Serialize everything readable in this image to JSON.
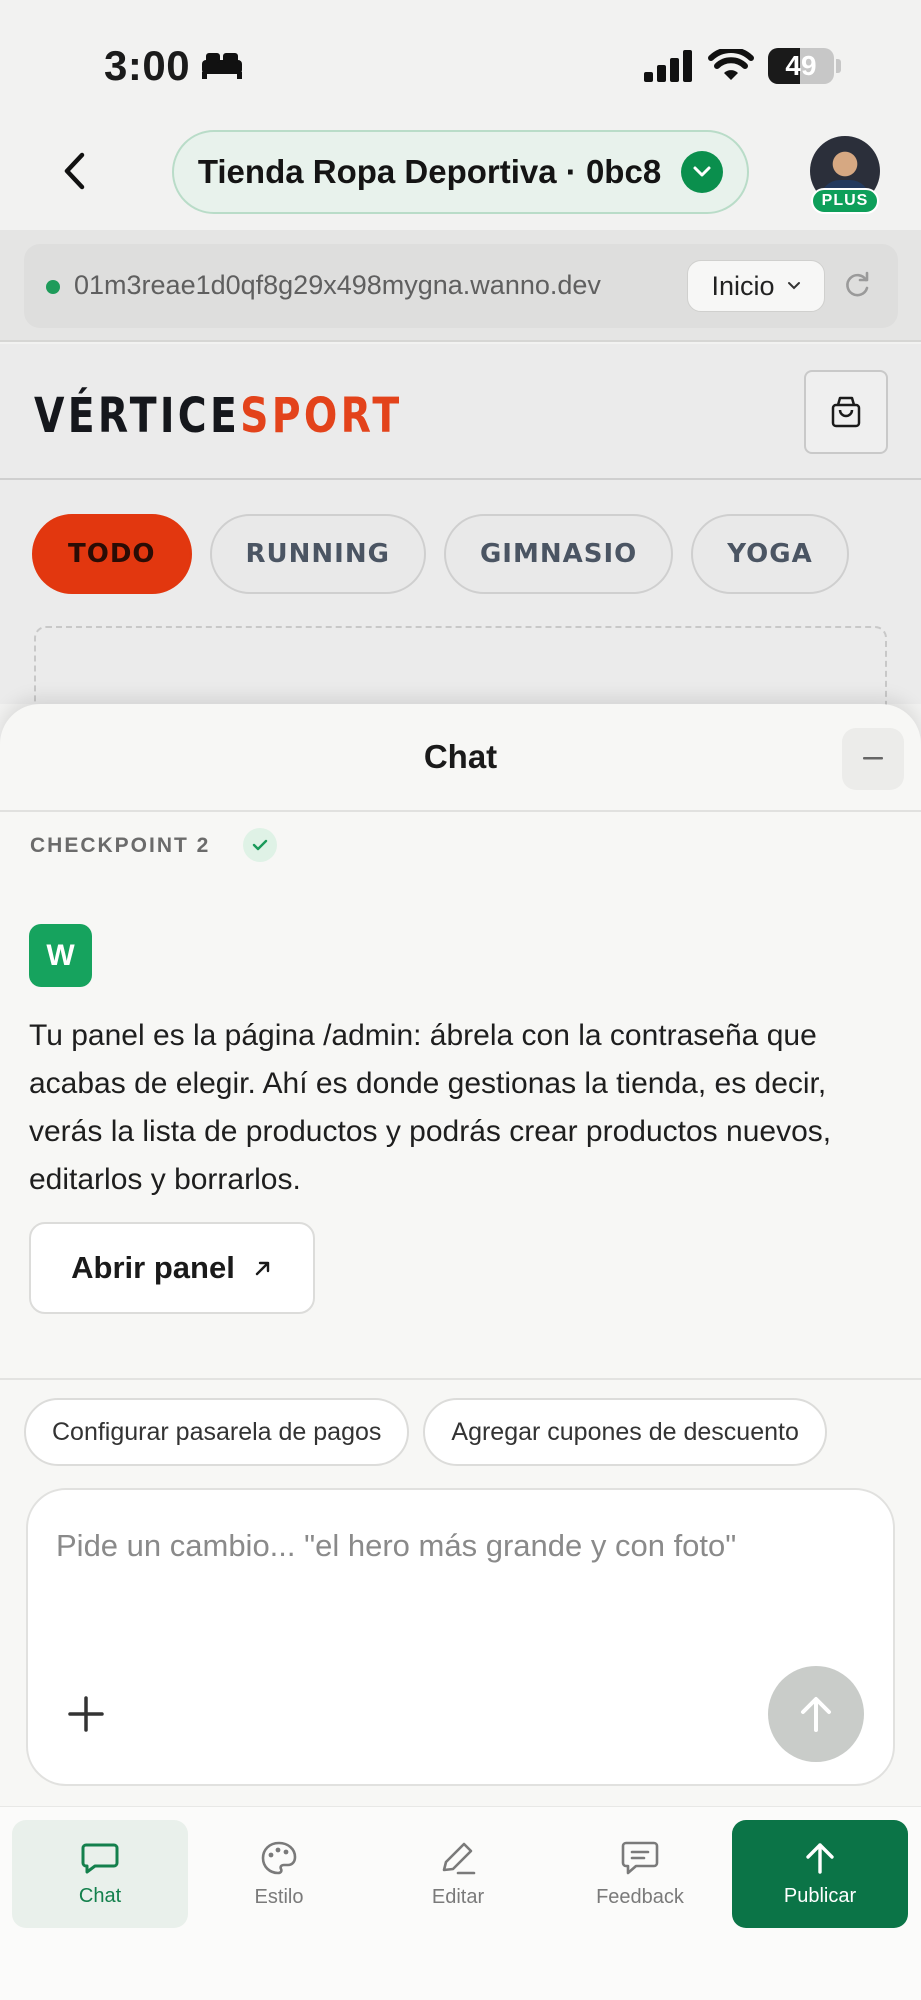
{
  "status_bar": {
    "time": "3:00",
    "battery": "49",
    "battery_level": 0.49
  },
  "header": {
    "project_name": "Tienda Ropa Deportiva · 0bc8",
    "badge": "PLUS"
  },
  "url_bar": {
    "url": "01m3reae1d0qf8g29x498mygna.wanno.dev",
    "route": "Inicio"
  },
  "preview": {
    "brand_part1": "VÉRTICE",
    "brand_part2": "SPORT",
    "categories": [
      "TODO",
      "RUNNING",
      "GIMNASIO",
      "YOGA"
    ],
    "active_category": "TODO"
  },
  "chat": {
    "title": "Chat",
    "checkpoint": "CHECKPOINT 2",
    "assistant_initial": "W",
    "message": "Tu panel es la página /admin: ábrela con la contraseña que acabas de elegir. Ahí es donde gestionas la tienda, es decir, verás la lista de productos y podrás crear productos nuevos, editarlos y borrarlos.",
    "open_panel_label": "Abrir panel",
    "suggestions": [
      "Configurar pasarela de pagos",
      "Agregar cupones de descuento"
    ],
    "input_placeholder": "Pide un cambio... \"el hero más grande y con foto\""
  },
  "tabbar": {
    "chat": "Chat",
    "style": "Estilo",
    "edit": "Editar",
    "feedback": "Feedback",
    "publish": "Publicar",
    "active": "Chat"
  },
  "colors": {
    "accent_green": "#0b7447",
    "brand_orange": "#e3431b",
    "active_category": "#e2370f"
  }
}
